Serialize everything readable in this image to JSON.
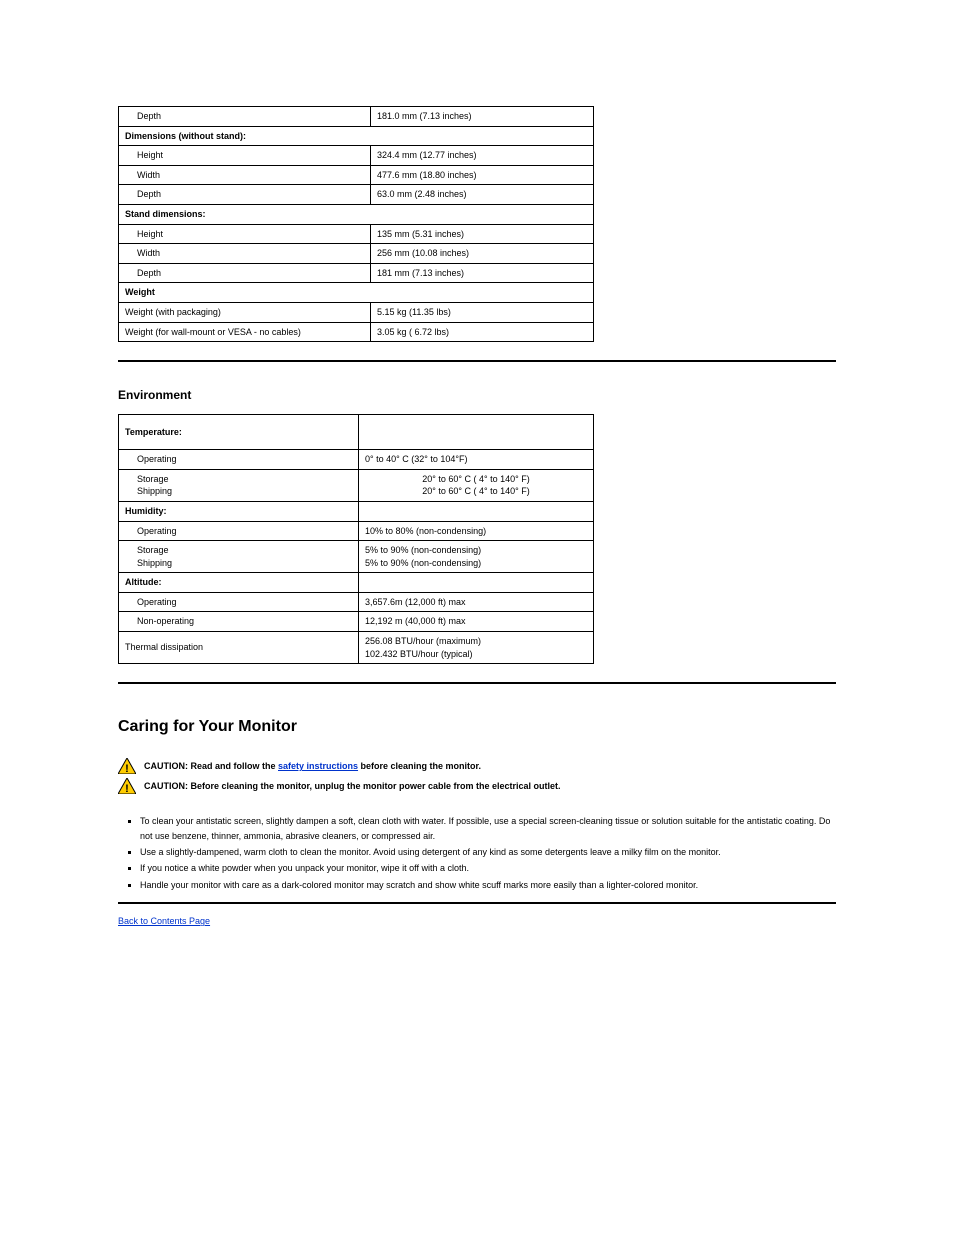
{
  "table1": {
    "r1": {
      "c1": "Depth",
      "c2": "181.0 mm (7.13 inches)"
    },
    "dimHead": "Dimensions (without stand):",
    "r3": {
      "c1": "Height",
      "c2": "324.4 mm (12.77 inches)"
    },
    "r4": {
      "c1": "Width",
      "c2": "477.6 mm (18.80 inches)"
    },
    "r5": {
      "c1": "Depth",
      "c2": "63.0 mm (2.48 inches)"
    },
    "standHead": "Stand dimensions:",
    "r7": {
      "c1": "Height",
      "c2": "135 mm (5.31 inches)"
    },
    "r8": {
      "c1": "Width",
      "c2": "256 mm (10.08 inches)"
    },
    "r9": {
      "c1": "Depth",
      "c2": "181 mm (7.13 inches)"
    },
    "weightHead": "Weight",
    "r11": {
      "c1": "Weight (with packaging)",
      "c2": "5.15 kg (11.35 lbs)"
    },
    "r12": {
      "c1": "Weight (for wall-mount or VESA - no cables)",
      "c2": "3.05 kg ( 6.72 lbs)"
    }
  },
  "envHead": "Environment",
  "table2": {
    "r1": {
      "c1": "Temperature:",
      "c2": ""
    },
    "r2": {
      "c1": "Operating",
      "c2": "0° to 40° C (32° to 104°F)"
    },
    "r3": {
      "c1": "Storage\nShipping",
      "c2": "20° to 60° C ( 4° to 140° F)\n20° to 60° C ( 4° to 140° F)"
    },
    "r4": {
      "c1": "Humidity:",
      "c2": ""
    },
    "r5": {
      "c1": "Operating",
      "c2": "10% to 80% (non-condensing)"
    },
    "r6": {
      "c1": "Storage\nShipping",
      "c2": "5% to 90% (non-condensing)\n5% to 90% (non-condensing)"
    },
    "r7": {
      "c1": "Altitude:",
      "c2": ""
    },
    "r8": {
      "c1": "Operating",
      "c2": "3,657.6m (12,000 ft) max"
    },
    "r9": {
      "c1": "Non-operating",
      "c2": "12,192 m (40,000 ft) max"
    },
    "r10": {
      "c1": "Thermal dissipation",
      "c2": "256.08 BTU/hour (maximum)\n102.432 BTU/hour (typical)"
    }
  },
  "caringHead": "Caring for Your Monitor",
  "warn1a": "CAUTION: Read and follow the ",
  "warn1link": "safety instructions",
  "warn1b": " before cleaning the monitor.",
  "warn2": "CAUTION: Before cleaning the monitor, unplug the monitor power cable from the electrical outlet.",
  "bul1": "To clean your antistatic screen, slightly dampen a soft, clean cloth with water. If possible, use a special screen-cleaning tissue or solution suitable for the antistatic coating. Do not use benzene, thinner, ammonia, abrasive cleaners, or compressed air.",
  "bul2": "Use a slightly-dampened, warm cloth to clean the monitor. Avoid using detergent of any kind as some detergents leave a milky film on the monitor.",
  "bul3": "If you notice a white powder when you unpack your monitor, wipe it off with a cloth.",
  "bul4": "Handle your monitor with care as a dark-colored monitor may scratch and show white scuff marks more easily than a lighter-colored monitor.",
  "back": "Back to Contents Page"
}
